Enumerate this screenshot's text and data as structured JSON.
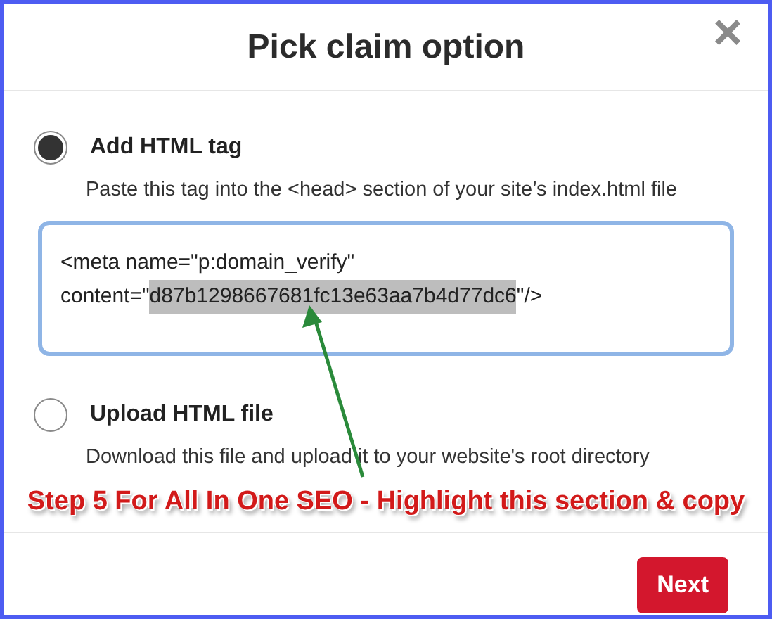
{
  "dialog": {
    "title": "Pick claim option",
    "close": "×"
  },
  "options": [
    {
      "label": "Add HTML tag",
      "description": "Paste this tag into the <head> section of your site’s index.html file",
      "selected": true,
      "kind": "tag"
    },
    {
      "label": "Upload HTML file",
      "description": "Download this file and upload it to your website's root directory",
      "selected": false,
      "kind": "file"
    }
  ],
  "tag_field": {
    "line_1": "<meta name=\"p:domain_verify\"",
    "line_2_before": "content=\"",
    "selection": "d87b1298667681fc13e63aa7b4d77dc6",
    "line_2_after": "\"/>"
  },
  "annotation": {
    "text": "Step 5 For All In One SEO - Highlight this section & copy"
  },
  "buttons": [
    {
      "label": "Next"
    }
  ]
}
